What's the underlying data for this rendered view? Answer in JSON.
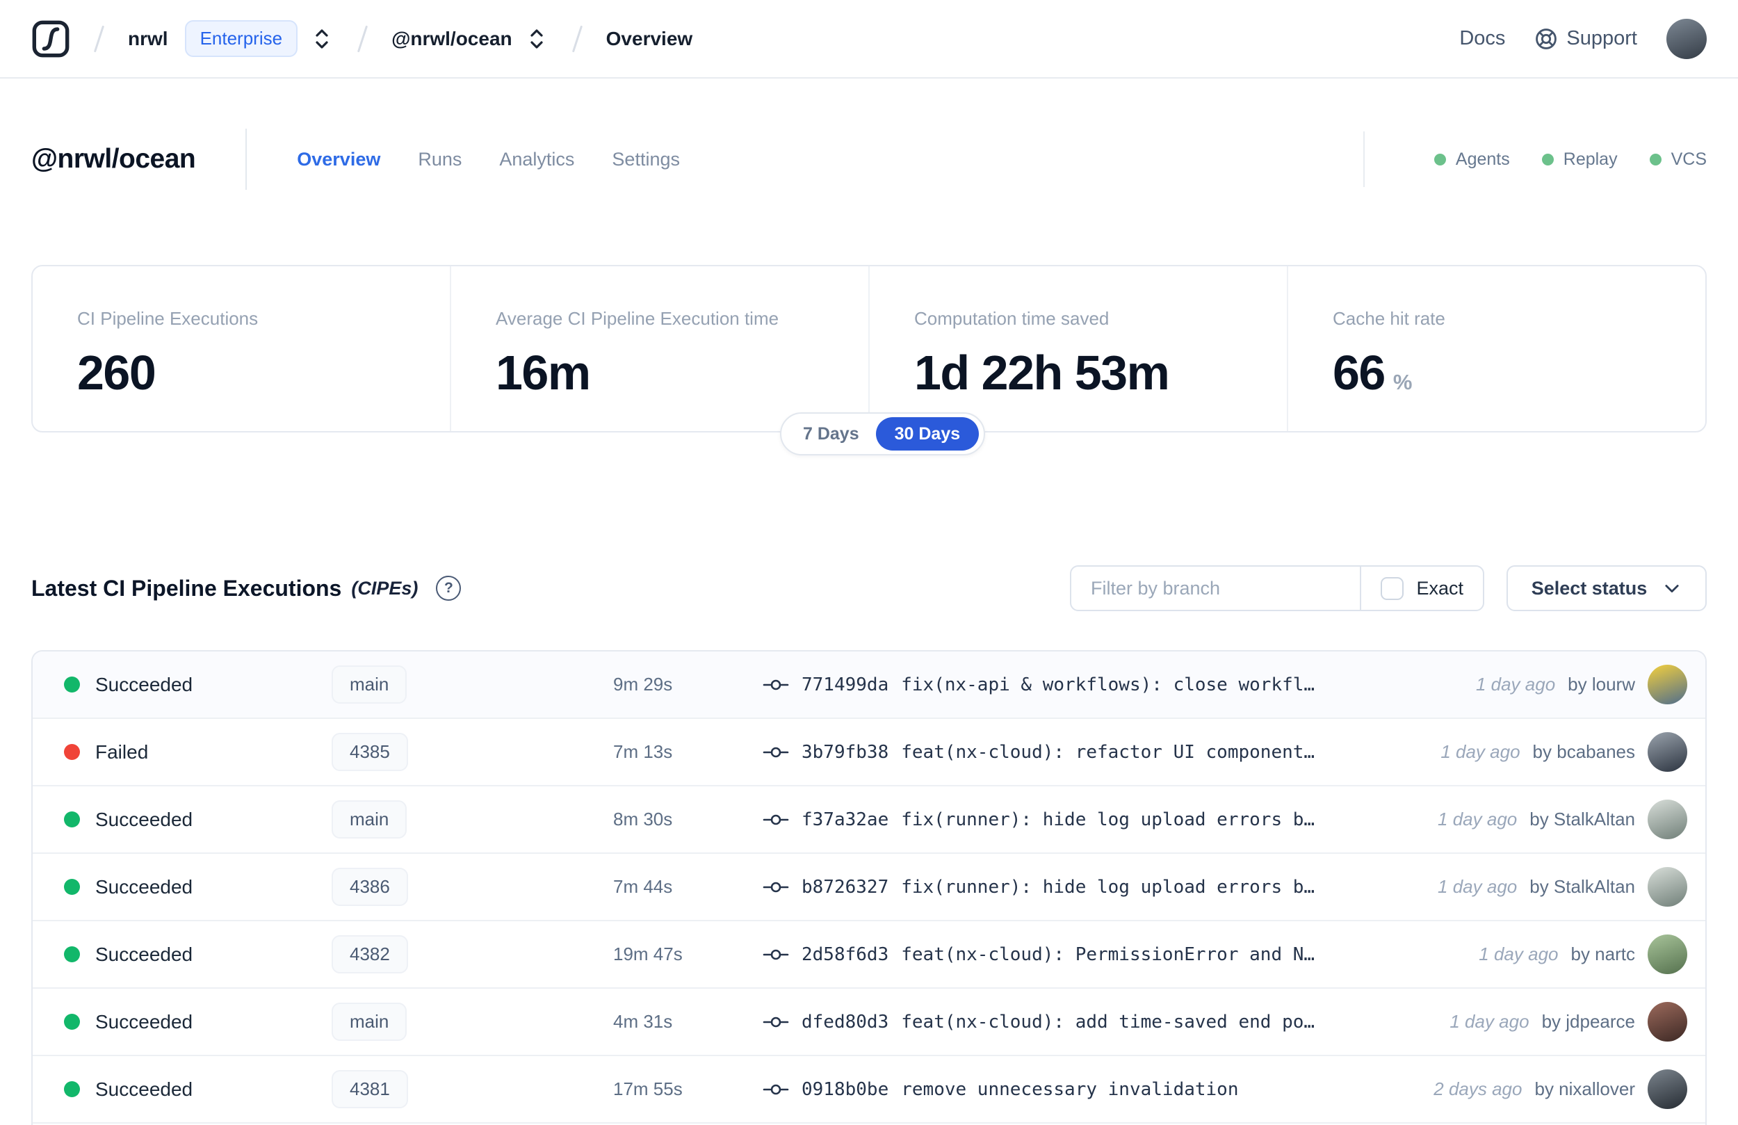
{
  "navbar": {
    "breadcrumb": {
      "org": "nrwl",
      "org_badge": "Enterprise",
      "workspace": "@nrwl/ocean",
      "page": "Overview"
    },
    "links": {
      "docs": "Docs",
      "support": "Support"
    },
    "avatar_colors": [
      "#7d8894",
      "#343c46"
    ]
  },
  "header": {
    "title": "@nrwl/ocean",
    "tabs": [
      {
        "label": "Overview",
        "active": true
      },
      {
        "label": "Runs",
        "active": false
      },
      {
        "label": "Analytics",
        "active": false
      },
      {
        "label": "Settings",
        "active": false
      }
    ],
    "statuses": [
      {
        "label": "Agents"
      },
      {
        "label": "Replay"
      },
      {
        "label": "VCS"
      }
    ]
  },
  "stats": {
    "cards": [
      {
        "label": "CI Pipeline Executions",
        "value": "260",
        "suffix": ""
      },
      {
        "label": "Average CI Pipeline Execution time",
        "value": "16m",
        "suffix": ""
      },
      {
        "label": "Computation time saved",
        "value": "1d 22h 53m",
        "suffix": ""
      },
      {
        "label": "Cache hit rate",
        "value": "66",
        "suffix": "%"
      }
    ],
    "range_toggle": {
      "options": [
        "7 Days",
        "30 Days"
      ],
      "selected": "30 Days"
    }
  },
  "cipe_section": {
    "title": "Latest CI Pipeline Executions",
    "title_suffix": "(CIPEs)",
    "help_glyph": "?",
    "filter": {
      "placeholder": "Filter by branch",
      "exact_label": "Exact",
      "status_label": "Select status"
    },
    "rows": [
      {
        "status": "Succeeded",
        "kind": "success",
        "branch": "main",
        "duration": "9m 29s",
        "hash": "771499da",
        "message": "fix(nx-api & workflows): close workfl…",
        "time": "1 day ago",
        "author": "by lourw",
        "avatar": [
          "#f4d03d",
          "#4f6d8c"
        ],
        "hovered": true
      },
      {
        "status": "Failed",
        "kind": "failed",
        "branch": "4385",
        "duration": "7m 13s",
        "hash": "3b79fb38",
        "message": "feat(nx-cloud): refactor UI component…",
        "time": "1 day ago",
        "author": "by bcabanes",
        "avatar": [
          "#9aa3ad",
          "#2c3440"
        ],
        "hovered": false
      },
      {
        "status": "Succeeded",
        "kind": "success",
        "branch": "main",
        "duration": "8m 30s",
        "hash": "f37a32ae",
        "message": "fix(runner): hide log upload errors b…",
        "time": "1 day ago",
        "author": "by StalkAltan",
        "avatar": [
          "#d8ded9",
          "#707f78"
        ],
        "hovered": false
      },
      {
        "status": "Succeeded",
        "kind": "success",
        "branch": "4386",
        "duration": "7m 44s",
        "hash": "b8726327",
        "message": "fix(runner): hide log upload errors b…",
        "time": "1 day ago",
        "author": "by StalkAltan",
        "avatar": [
          "#d8ded9",
          "#707f78"
        ],
        "hovered": false
      },
      {
        "status": "Succeeded",
        "kind": "success",
        "branch": "4382",
        "duration": "19m 47s",
        "hash": "2d58f6d3",
        "message": "feat(nx-cloud): PermissionError and N…",
        "time": "1 day ago",
        "author": "by nartc",
        "avatar": [
          "#a8c49a",
          "#55714e"
        ],
        "hovered": false
      },
      {
        "status": "Succeeded",
        "kind": "success",
        "branch": "main",
        "duration": "4m 31s",
        "hash": "dfed80d3",
        "message": "feat(nx-cloud): add time-saved end po…",
        "time": "1 day ago",
        "author": "by jdpearce",
        "avatar": [
          "#9c6a5c",
          "#3c2824"
        ],
        "hovered": false
      },
      {
        "status": "Succeeded",
        "kind": "success",
        "branch": "4381",
        "duration": "17m 55s",
        "hash": "0918b0be",
        "message": "remove unnecessary invalidation",
        "time": "2 days ago",
        "author": "by nixallover",
        "avatar": [
          "#7b848d",
          "#262c33"
        ],
        "hovered": false
      }
    ]
  },
  "colors": {
    "accent_blue": "#2e6be6",
    "pill_blue": "#2b5ada",
    "success_dot": "#12b76a",
    "failed_dot": "#f04438",
    "header_dot": "#6cc18b"
  }
}
